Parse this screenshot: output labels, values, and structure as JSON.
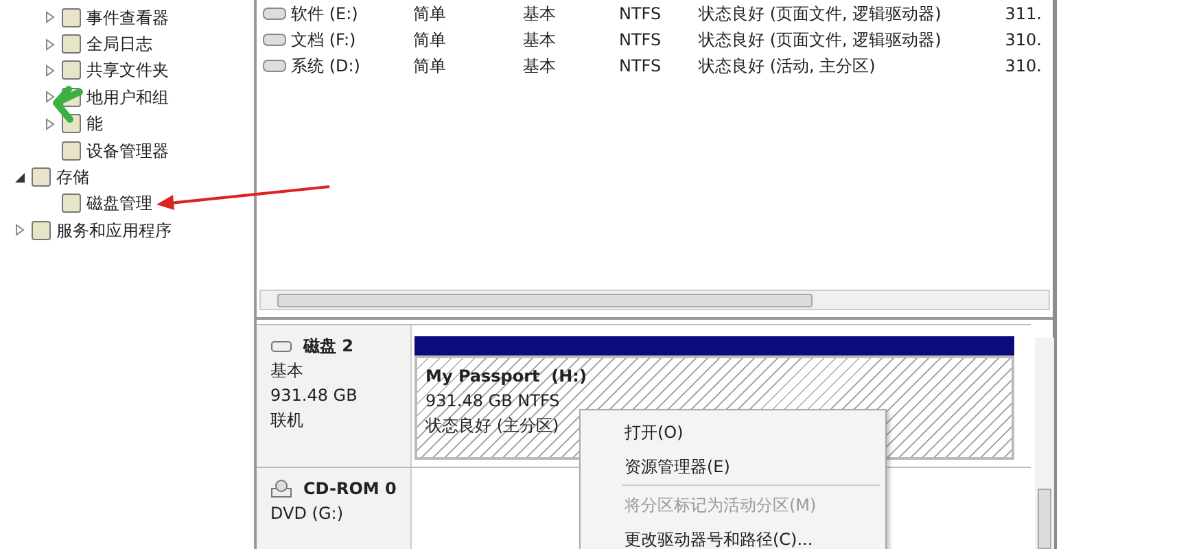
{
  "tree": [
    {
      "children": [
        {
          "label": "事件查看器",
          "expanded": false
        },
        {
          "label": "全局日志",
          "expanded": false
        },
        {
          "label": "共享文件夹",
          "expanded": false
        },
        {
          "label": "地用户和组",
          "expanded": false
        },
        {
          "label": "能",
          "expanded": false
        },
        {
          "label": "设备管理器"
        }
      ]
    },
    {
      "label": "存储",
      "expanded": true,
      "children": [
        {
          "label": "磁盘管理"
        }
      ]
    },
    {
      "label": "服务和应用程序",
      "expanded": false
    }
  ],
  "volumes": [
    {
      "name": "软件 (E:)",
      "layout": "简单",
      "type": "基本",
      "fs": "NTFS",
      "status": "状态良好 (页面文件, 逻辑驱动器)",
      "capacity": "311."
    },
    {
      "name": "文档 (F:)",
      "layout": "简单",
      "type": "基本",
      "fs": "NTFS",
      "status": "状态良好 (页面文件, 逻辑驱动器)",
      "capacity": "310."
    },
    {
      "name": "系统 (D:)",
      "layout": "简单",
      "type": "基本",
      "fs": "NTFS",
      "status": "状态良好 (活动, 主分区)",
      "capacity": "310."
    }
  ],
  "disks": [
    {
      "kind": "disk",
      "name": "磁盘 2",
      "lines": [
        "基本",
        "931.48 GB",
        "联机"
      ],
      "partitions": [
        {
          "name": "My Passport  (H:)",
          "size": "931.48 GB NTFS",
          "status": "状态良好 (主分区)",
          "selected": true
        }
      ]
    },
    {
      "kind": "cdrom",
      "name": "CD-ROM 0",
      "lines": [
        "DVD (G:)"
      ]
    }
  ],
  "context_menu": [
    {
      "kind": "item",
      "label": "打开(O)",
      "disabled": false
    },
    {
      "kind": "item",
      "label": "资源管理器(E)",
      "disabled": false
    },
    {
      "kind": "separator"
    },
    {
      "kind": "item",
      "label": "将分区标记为活动分区(M)",
      "disabled": true
    },
    {
      "kind": "item",
      "label": "更改驱动器号和路径(C)...",
      "disabled": false
    }
  ]
}
